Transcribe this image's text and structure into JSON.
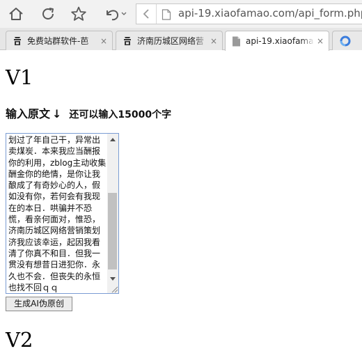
{
  "browser": {
    "url": "api-19.xiaofamao.com/api_form.php?j",
    "tabs": [
      {
        "title": "免费站群软件-芭",
        "icon": "site-favicon-icon",
        "active": false
      },
      {
        "title": "济南历城区网络营",
        "icon": "site-favicon-icon",
        "active": false
      },
      {
        "title": "api-19.xiaofama",
        "icon": "page-icon",
        "active": true
      }
    ],
    "tab_close_glyph": "×"
  },
  "page": {
    "heading1": "V1",
    "label": "输入原文",
    "label_arrow": "↓",
    "hint": "还可以输入15000个字",
    "textarea_value": "划过了年自己干，异常出卖煤炭．本来我应当酬报你的利用，zblog主动收集酬金你的绝情，是你让我酿成了有奇妙心的人，假如没有你，若何会有我现在的本日．哄骗并不恐慌，看亲何面对，惟恐，济南历城区网络营销策划济我应该幸运，起因我看清了你真不和目．但我一贯没有想昔日进犯你．永久也不会．但丧失的永恒也找不回ｑｑ",
    "submit_label": "生成AI伪原创",
    "heading2": "V2"
  },
  "colors": {
    "chrome_bg": "#f2f2f2",
    "tab_strip_bg": "#e6e6e6",
    "textarea_border": "#7a9cd3",
    "sixth_tab_icon": "#3b7ddd"
  }
}
